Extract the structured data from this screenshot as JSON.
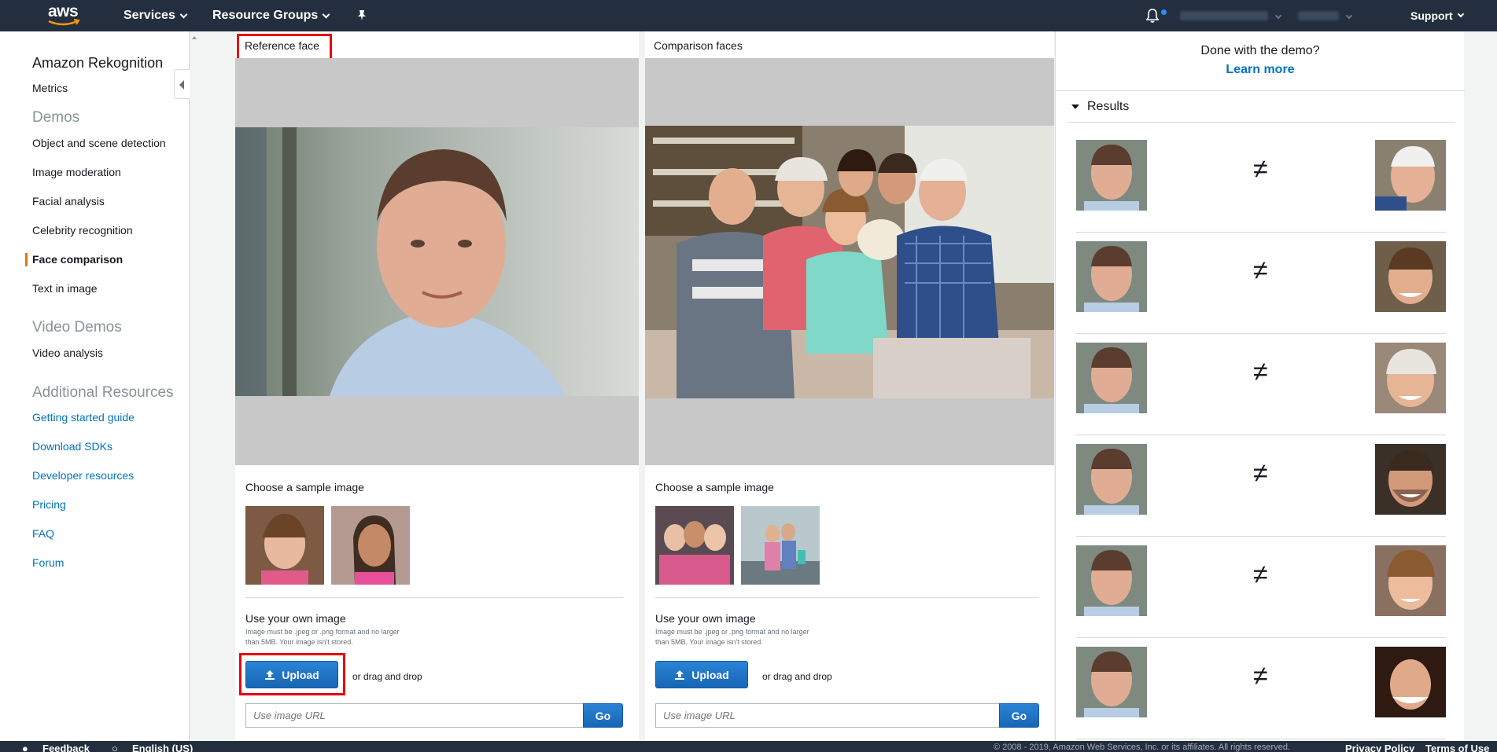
{
  "nav": {
    "logo": "aws",
    "services_label": "Services",
    "resource_groups_label": "Resource Groups",
    "support_label": "Support"
  },
  "sidebar": {
    "title": "Amazon Rekognition",
    "metrics": "Metrics",
    "demos_section": "Demos",
    "demos": [
      "Object and scene detection",
      "Image moderation",
      "Facial analysis",
      "Celebrity recognition",
      "Face comparison",
      "Text in image"
    ],
    "active_item": "Face comparison",
    "video_section": "Video Demos",
    "video_items": [
      "Video analysis"
    ],
    "resources_section": "Additional Resources",
    "resources": [
      "Getting started guide",
      "Download SDKs",
      "Developer resources",
      "Pricing",
      "FAQ",
      "Forum"
    ]
  },
  "reference": {
    "label": "Reference face",
    "choose_label": "Choose a sample image",
    "own_title": "Use your own image",
    "own_note": "Image must be .jpeg or .png format and no larger than 5MB. Your image isn't stored.",
    "upload_label": "Upload",
    "drag_label": "or drag and drop",
    "url_placeholder": "Use image URL",
    "go_label": "Go"
  },
  "comparison": {
    "label": "Comparison faces",
    "choose_label": "Choose a sample image",
    "own_title": "Use your own image",
    "own_note": "Image must be .jpeg or .png format and no larger than 5MB. Your image isn't stored.",
    "upload_label": "Upload",
    "drag_label": "or drag and drop",
    "url_placeholder": "Use image URL",
    "go_label": "Go"
  },
  "results": {
    "done_text": "Done with the demo?",
    "learn_more": "Learn more",
    "heading": "Results",
    "match_symbol": "≠",
    "rows": 6
  },
  "footer": {
    "feedback": "Feedback",
    "language": "English (US)",
    "copyright": "© 2008 - 2019, Amazon Web Services, Inc. or its affiliates. All rights reserved.",
    "privacy": "Privacy Policy",
    "terms": "Terms of Use"
  },
  "colors": {
    "nav_bg": "#232f3e",
    "link": "#0073bb",
    "button": "#1766b5",
    "active_marker": "#ec7211",
    "highlight_box": "#e8000b"
  }
}
